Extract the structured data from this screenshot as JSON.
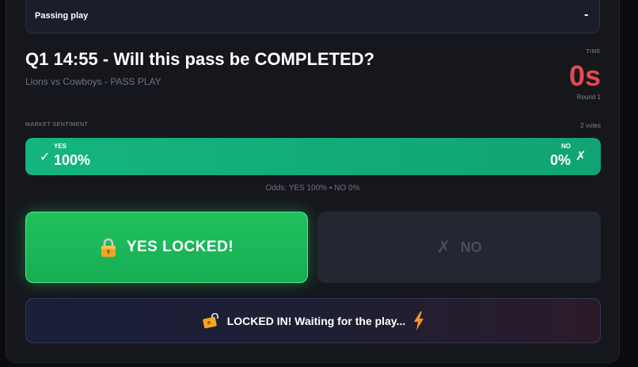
{
  "play_bar": {
    "label": "Passing play",
    "toggle": "-"
  },
  "question": {
    "title": "Q1 14:55 - Will this pass be COMPLETED?",
    "subtitle": "Lions vs Cowboys - PASS PLAY"
  },
  "timer": {
    "label": "TIME",
    "value": "0s",
    "round": "Round 1"
  },
  "sentiment": {
    "label": "MARKET SENTIMENT",
    "votes": "2 votes",
    "yes_label": "YES",
    "yes_pct": "100%",
    "no_label": "NO",
    "no_pct": "0%",
    "yes_share": 100,
    "check_symbol": "✓",
    "x_symbol": "✗",
    "odds": "Odds: YES 100% • NO 0%"
  },
  "buttons": {
    "yes_label": "YES LOCKED!",
    "no_label": "NO",
    "no_symbol": "✗"
  },
  "status": {
    "text": "LOCKED IN! Waiting for the play..."
  },
  "colors": {
    "yes_green": "#21c15e",
    "sentiment_green": "#14b57f",
    "timer_red": "#e24a50",
    "no_disabled": "#242631"
  },
  "icons": {
    "lock": "lock-icon",
    "tag": "lock-tag-icon",
    "bolt": "lightning-icon"
  }
}
